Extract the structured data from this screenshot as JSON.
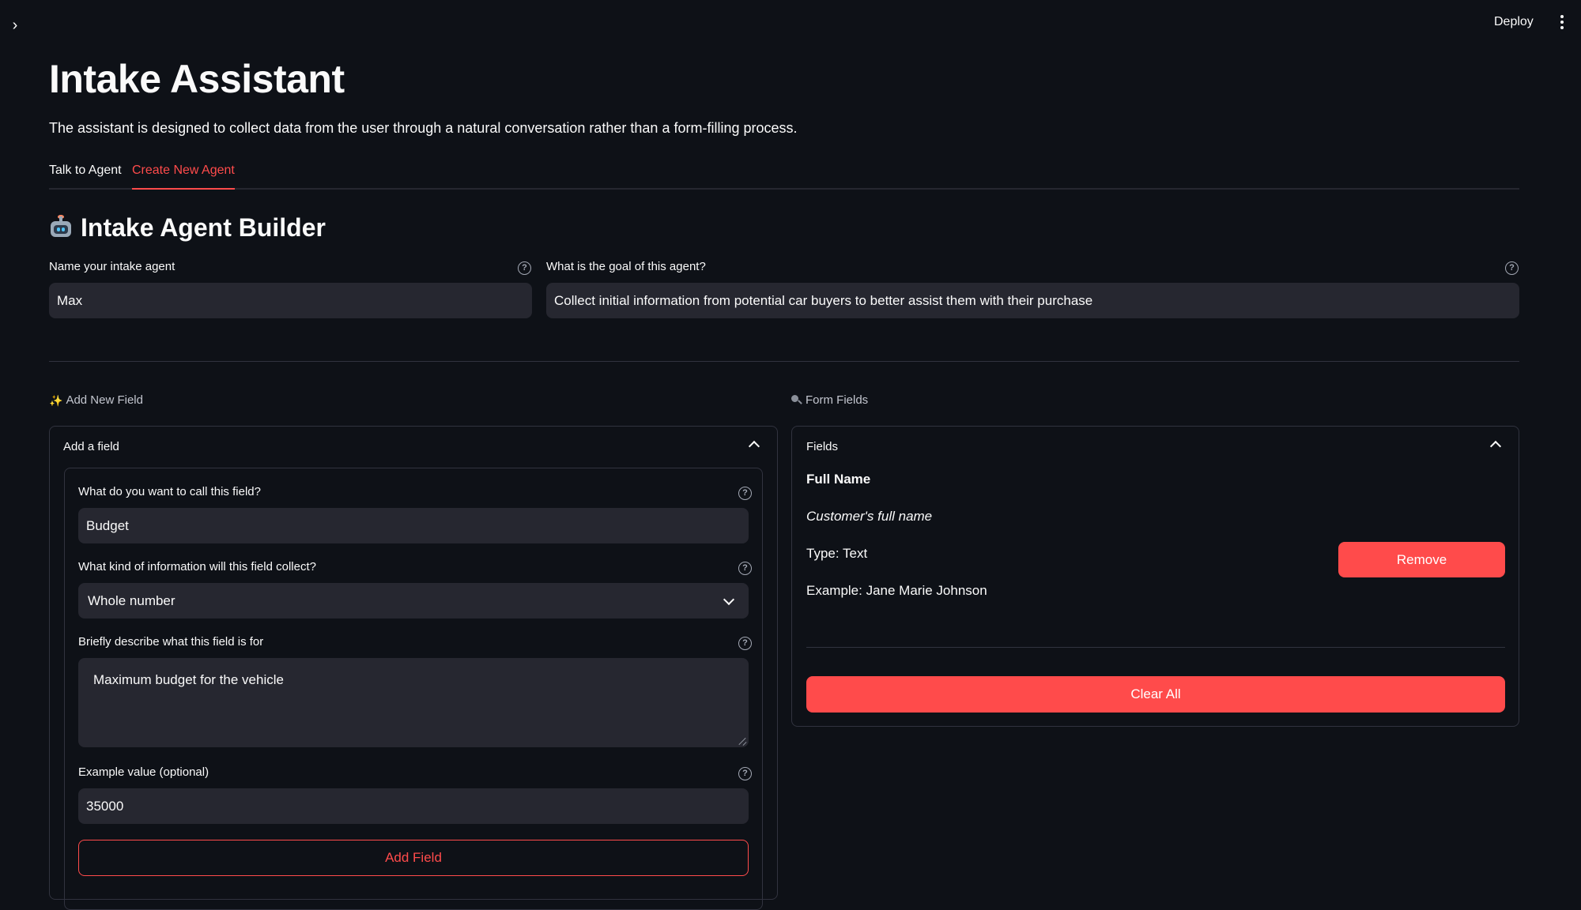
{
  "header": {
    "deploy_label": "Deploy"
  },
  "page": {
    "title": "Intake Assistant",
    "subtitle": "The assistant is designed to collect data from the user through a natural conversation rather than a form-filling process."
  },
  "tabs": [
    {
      "label": "Talk to Agent",
      "active": false
    },
    {
      "label": "Create New Agent",
      "active": true
    }
  ],
  "builder": {
    "heading": "Intake Agent Builder",
    "name_label": "Name your intake agent",
    "name_value": "Max",
    "goal_label": "What is the goal of this agent?",
    "goal_value": "Collect initial information from potential car buyers to better assist them with their purchase"
  },
  "add_section": {
    "caption": "Add New Field",
    "expander_title": "Add a field",
    "field_name_label": "What do you want to call this field?",
    "field_name_value": "Budget",
    "type_label": "What kind of information will this field collect?",
    "type_value": "Whole number",
    "desc_label": "Briefly describe what this field is for",
    "desc_value": "Maximum budget for the vehicle",
    "example_label": "Example value (optional)",
    "example_value": "35000",
    "add_button": "Add Field"
  },
  "fields_section": {
    "caption": "Form Fields",
    "expander_title": "Fields",
    "fields": [
      {
        "name": "Full Name",
        "description": "Customer's full name",
        "type": "Type: Text",
        "example": "Example: Jane Marie Johnson",
        "remove_label": "Remove"
      }
    ],
    "clear_button": "Clear All"
  },
  "icons": {
    "sidebar_toggle": "chevron-right-icon",
    "menu": "more-vertical-icon",
    "help": "help-circle-icon",
    "robot": "robot-emoji-icon",
    "sparkles": "sparkles-icon",
    "magnifier": "magnifying-glass-icon"
  },
  "colors": {
    "accent": "#ff4b4b",
    "background": "#0e1117",
    "input_bg": "#262730"
  }
}
